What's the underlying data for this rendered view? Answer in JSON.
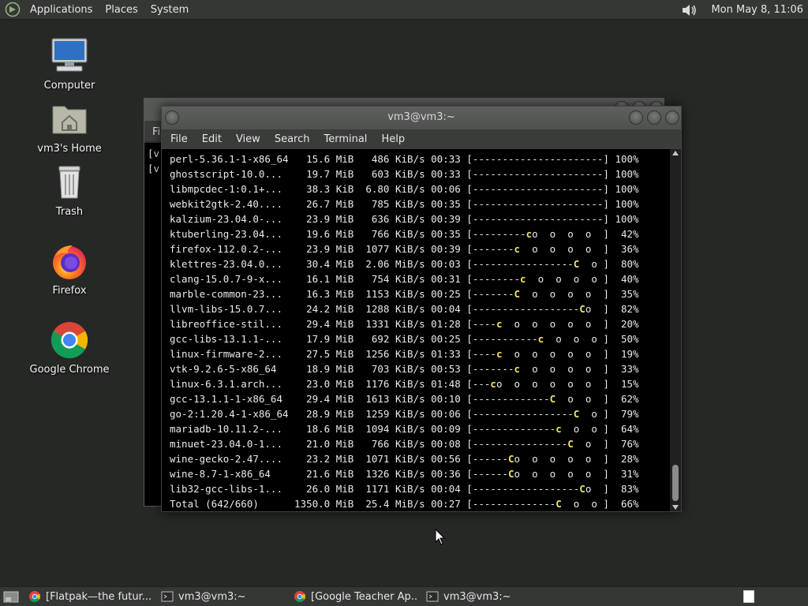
{
  "top_panel": {
    "menus": [
      "Applications",
      "Places",
      "System"
    ],
    "clock": "Mon May  8, 11:06"
  },
  "desktop_icons": [
    {
      "label": "Computer",
      "icon": "computer-icon"
    },
    {
      "label": "vm3's Home",
      "icon": "home-folder-icon"
    },
    {
      "label": "Trash",
      "icon": "trash-icon"
    },
    {
      "label": "Firefox",
      "icon": "firefox-icon"
    },
    {
      "label": "Google Chrome",
      "icon": "chrome-icon"
    }
  ],
  "background_window": {
    "menu_fragment": "Fi",
    "line_fragments": [
      "[v",
      "[v"
    ]
  },
  "terminal": {
    "title": "vm3@vm3:~",
    "menus": [
      "File",
      "Edit",
      "View",
      "Search",
      "Terminal",
      "Help"
    ],
    "lines": [
      {
        "name": "perl-5.36.1-1-x86_64",
        "size": "15.6 MiB",
        "rate": "486 KiB/s",
        "eta": "00:33",
        "bar": "[----------------------]",
        "pct": "100%"
      },
      {
        "name": "ghostscript-10.0...",
        "size": "19.7 MiB",
        "rate": "603 KiB/s",
        "eta": "00:33",
        "bar": "[----------------------]",
        "pct": "100%"
      },
      {
        "name": "libmpcdec-1:0.1+...",
        "size": "38.3 KiB",
        "rate": "6.80 KiB/s",
        "eta": "00:06",
        "bar": "[----------------------]",
        "pct": "100%"
      },
      {
        "name": "webkit2gtk-2.40....",
        "size": "26.7 MiB",
        "rate": "785 KiB/s",
        "eta": "00:35",
        "bar": "[----------------------]",
        "pct": "100%"
      },
      {
        "name": "kalzium-23.04.0-...",
        "size": "23.9 MiB",
        "rate": "636 KiB/s",
        "eta": "00:39",
        "bar": "[----------------------]",
        "pct": "100%"
      },
      {
        "name": "ktuberling-23.04...",
        "size": "19.6 MiB",
        "rate": "766 KiB/s",
        "eta": "00:35",
        "bar": "[---------co  o  o  o  ]",
        "pct": "42%"
      },
      {
        "name": "firefox-112.0.2-...",
        "size": "23.9 MiB",
        "rate": "1077 KiB/s",
        "eta": "00:39",
        "bar": "[-------c  o  o  o  o  ]",
        "pct": "36%"
      },
      {
        "name": "klettres-23.04.0...",
        "size": "30.4 MiB",
        "rate": "2.06 MiB/s",
        "eta": "00:03",
        "bar": "[-----------------C  o ]",
        "pct": "80%"
      },
      {
        "name": "clang-15.0.7-9-x...",
        "size": "16.1 MiB",
        "rate": "754 KiB/s",
        "eta": "00:31",
        "bar": "[--------c  o  o  o  o ]",
        "pct": "40%"
      },
      {
        "name": "marble-common-23...",
        "size": "16.3 MiB",
        "rate": "1153 KiB/s",
        "eta": "00:25",
        "bar": "[-------C  o  o  o  o  ]",
        "pct": "35%"
      },
      {
        "name": "llvm-libs-15.0.7...",
        "size": "24.2 MiB",
        "rate": "1288 KiB/s",
        "eta": "00:04",
        "bar": "[------------------Co  ]",
        "pct": "82%"
      },
      {
        "name": "libreoffice-stil...",
        "size": "29.4 MiB",
        "rate": "1331 KiB/s",
        "eta": "01:28",
        "bar": "[----c  o  o  o  o  o  ]",
        "pct": "20%"
      },
      {
        "name": "gcc-libs-13.1.1-...",
        "size": "17.9 MiB",
        "rate": "692 KiB/s",
        "eta": "00:25",
        "bar": "[-----------c  o  o  o ]",
        "pct": "50%"
      },
      {
        "name": "linux-firmware-2...",
        "size": "27.5 MiB",
        "rate": "1256 KiB/s",
        "eta": "01:33",
        "bar": "[----c  o  o  o  o  o  ]",
        "pct": "19%"
      },
      {
        "name": "vtk-9.2.6-5-x86_64",
        "size": "18.9 MiB",
        "rate": "703 KiB/s",
        "eta": "00:53",
        "bar": "[-------c  o  o  o  o  ]",
        "pct": "33%"
      },
      {
        "name": "linux-6.3.1.arch...",
        "size": "23.0 MiB",
        "rate": "1176 KiB/s",
        "eta": "01:48",
        "bar": "[---co  o  o  o  o  o  ]",
        "pct": "15%"
      },
      {
        "name": "gcc-13.1.1-1-x86_64",
        "size": "29.4 MiB",
        "rate": "1613 KiB/s",
        "eta": "00:10",
        "bar": "[-------------C  o  o  ]",
        "pct": "62%"
      },
      {
        "name": "go-2:1.20.4-1-x86_64",
        "size": "28.9 MiB",
        "rate": "1259 KiB/s",
        "eta": "00:06",
        "bar": "[-----------------C  o ]",
        "pct": "79%"
      },
      {
        "name": "mariadb-10.11.2-...",
        "size": "18.6 MiB",
        "rate": "1094 KiB/s",
        "eta": "00:09",
        "bar": "[--------------c  o  o ]",
        "pct": "64%"
      },
      {
        "name": "minuet-23.04.0-1...",
        "size": "21.0 MiB",
        "rate": "766 KiB/s",
        "eta": "00:08",
        "bar": "[----------------C  o  ]",
        "pct": "76%"
      },
      {
        "name": "wine-gecko-2.47....",
        "size": "23.2 MiB",
        "rate": "1071 KiB/s",
        "eta": "00:56",
        "bar": "[------Co  o  o  o  o  ]",
        "pct": "28%"
      },
      {
        "name": "wine-8.7-1-x86_64",
        "size": "21.6 MiB",
        "rate": "1326 KiB/s",
        "eta": "00:36",
        "bar": "[------Co  o  o  o  o  ]",
        "pct": "31%"
      },
      {
        "name": "lib32-gcc-libs-1...",
        "size": "26.0 MiB",
        "rate": "1171 KiB/s",
        "eta": "00:04",
        "bar": "[------------------Co  ]",
        "pct": "83%"
      },
      {
        "name": "Total (642/660)",
        "size": "1350.0 MiB",
        "rate": "25.4 MiB/s",
        "eta": "00:27",
        "bar": "[--------------C  o  o ]",
        "pct": "66%"
      }
    ]
  },
  "taskbar": {
    "tasks": [
      {
        "label": "[Flatpak—the futur...",
        "icon": "chrome-icon"
      },
      {
        "label": "vm3@vm3:~",
        "icon": "terminal-icon"
      },
      {
        "label": "[Google Teacher Ap...",
        "icon": "chrome-icon"
      },
      {
        "label": "vm3@vm3:~",
        "icon": "terminal-icon"
      }
    ]
  },
  "colors": {
    "desktop_bg": "#262826",
    "panel_bg": "#353735",
    "terminal_bg": "#000000",
    "pacman_yellow": "#f2e36a"
  }
}
